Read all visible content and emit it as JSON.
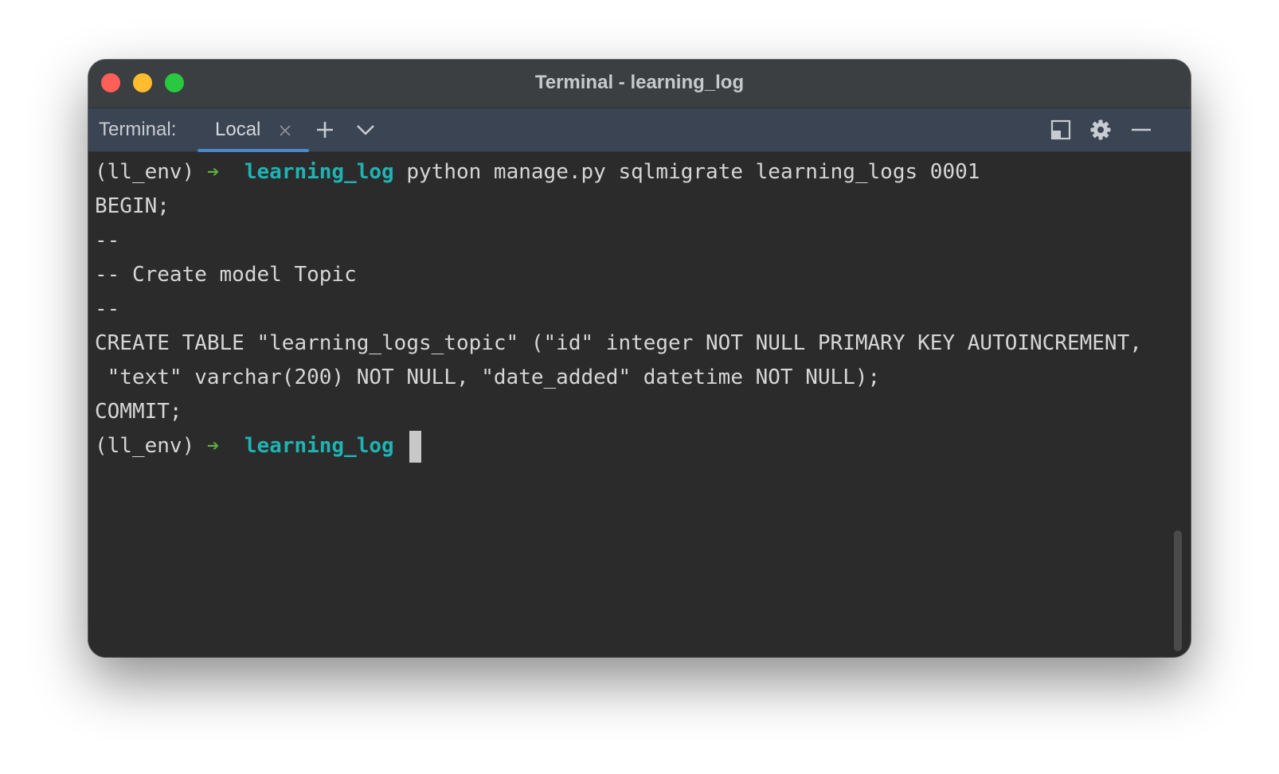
{
  "window": {
    "title": "Terminal - learning_log"
  },
  "toolbar": {
    "label": "Terminal:",
    "tab_label": "Local",
    "icons": [
      "close-icon",
      "plus-icon",
      "chevron-down-icon",
      "layout-icon",
      "gear-icon",
      "minimize-icon"
    ]
  },
  "terminal": {
    "prompt_env": "(ll_env)",
    "prompt_arrow": "➔",
    "prompt_dir": "learning_log",
    "command": "python manage.py sqlmigrate learning_logs 0001",
    "output": [
      "BEGIN;",
      "--",
      "-- Create model Topic",
      "--",
      "CREATE TABLE \"learning_logs_topic\" (\"id\" integer NOT NULL PRIMARY KEY AUTOINCREMENT,",
      " \"text\" varchar(200) NOT NULL, \"date_added\" datetime NOT NULL);",
      "COMMIT;"
    ]
  },
  "colors": {
    "prompt_dir": "#1fb3b3",
    "prompt_arrow": "#5fb13b",
    "tab_underline": "#4a88c7",
    "terminal_bg": "#2b2b2b",
    "toolbar_bg": "#3b4452"
  }
}
